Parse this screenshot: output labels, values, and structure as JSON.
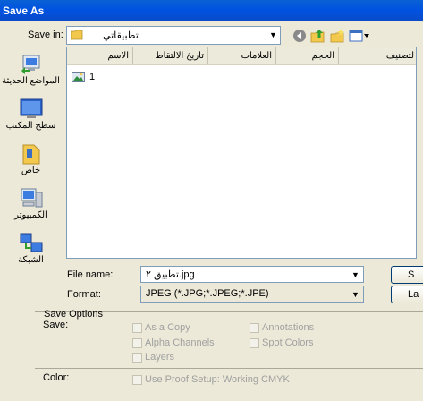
{
  "window": {
    "title": "Save As"
  },
  "toolbar": {
    "save_in_label": "Save in:",
    "save_in_value": "تطبيقاتي",
    "icons": [
      "back-icon",
      "up-folder-icon",
      "new-folder-icon",
      "views-menu-icon"
    ]
  },
  "places": [
    {
      "label": "المواضع الحديثة",
      "icon": "recent-places-icon"
    },
    {
      "label": "سطح المكتب",
      "icon": "desktop-icon"
    },
    {
      "label": "خاص",
      "icon": "personal-folder-icon"
    },
    {
      "label": "الكمبيوتر",
      "icon": "computer-icon"
    },
    {
      "label": "الشبكة",
      "icon": "network-icon"
    }
  ],
  "file_list": {
    "columns": [
      "الاسم",
      "تاريخ الالتقاط",
      "العلامات",
      "الحجم",
      "لتصنيف"
    ],
    "items": [
      {
        "name": "1",
        "icon": "image-file-icon"
      }
    ]
  },
  "form": {
    "file_name_label": "File name:",
    "file_name_value": "تطبيق ٢.jpg",
    "format_label": "Format:",
    "format_value": "JPEG (*.JPG;*.JPEG;*.JPE)",
    "save_button_fragment": "S",
    "cancel_button_fragment": "La"
  },
  "save_options": {
    "group_title": "Save Options",
    "save_label": "Save:",
    "as_a_copy": "As a Copy",
    "annotations": "Annotations",
    "alpha_channels": "Alpha Channels",
    "spot_colors": "Spot Colors",
    "layers": "Layers",
    "color_label": "Color:",
    "use_proof_setup": "Use Proof Setup:  Working CMYK"
  },
  "colors": {
    "title_bar": "#0053e1",
    "dialog_bg": "#ece9d8",
    "border": "#7f9db9"
  }
}
